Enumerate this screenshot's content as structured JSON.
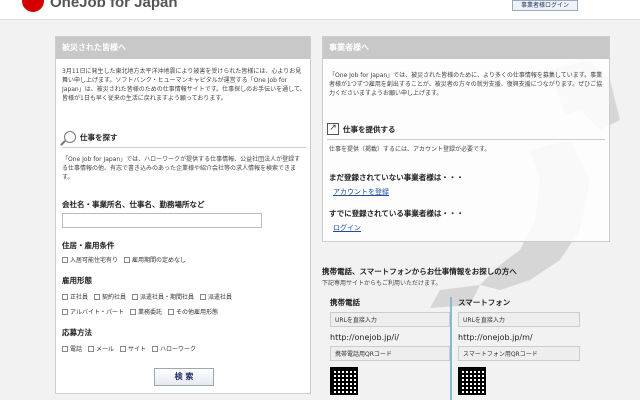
{
  "header": {
    "logo": "OneJob for Japan",
    "login": "事業者様ログイン"
  },
  "left": {
    "title": "被災された皆様へ",
    "intro": "3月11日に発生した東北地方太平洋沖地震により被害を受けられた皆様には、心よりお見舞い申し上げます。ソフトバンク・ヒューマンキャピタルが運営する「One Job for Japan」は、被災された皆様のための仕事情報サイトです。仕事探しのお手伝いを通して、皆様が1日も早く従来の生活に戻れますよう願っております。",
    "search_title": "仕事を探す",
    "search_desc": "「One Job for Japan」では、ハローワークが提供する仕事情報、公益社団法人が登録する仕事情報の他、有志で書き込みのあった企業様や紹介会社等の求人情報を検索できます。",
    "keyword_label": "会社名・事業所名、仕事名、勤務場所など",
    "cond_label": "住居・雇用条件",
    "cond_opts": [
      "入居可能住宅有り",
      "雇用期間の定めなし"
    ],
    "type_label": "雇用形態",
    "type_opts1": [
      "正社員",
      "契約社員",
      "派遣社員・期間社員",
      "派遣社員"
    ],
    "type_opts2": [
      "アルバイト・パート",
      "業務委託",
      "その他雇用形態"
    ],
    "apply_label": "応募方法",
    "apply_opts": [
      "電話",
      "メール",
      "サイト",
      "ハローワーク"
    ],
    "search_btn": "検 索"
  },
  "right": {
    "title": "事業者様へ",
    "intro": "「One Job for Japan」では、被災された皆様のために、より多くの仕事情報を募集しています。事業者様が1つずつ雇用を創出することが、被災者の方々の就労支援、復興支援につながります。ぜひご協力くださいますようお願い申し上げます。",
    "post_title": "仕事を提供する",
    "post_desc": "仕事を提供（掲載）するには、アカウント登録が必要です。",
    "not_registered": "まだ登録されていない事業者様は・・・",
    "register_link": "アカウントを登録",
    "registered": "すでに登録されている事業者様は・・・",
    "login_link": "ログイン"
  },
  "mobile": {
    "title": "携帯電話、スマートフォンからお仕事情報をお探しの方へ",
    "desc": "下記専用サイトからもご利用いただけます。",
    "cols": [
      {
        "label": "携帯電話",
        "field": "URLを直接入力",
        "url": "http://onejob.jp/i/",
        "qr": "携帯電話用QRコード"
      },
      {
        "label": "スマートフォン",
        "field": "URLを直接入力",
        "url": "http://onejob.jp/m/",
        "qr": "スマートフォン用QRコード"
      }
    ]
  }
}
